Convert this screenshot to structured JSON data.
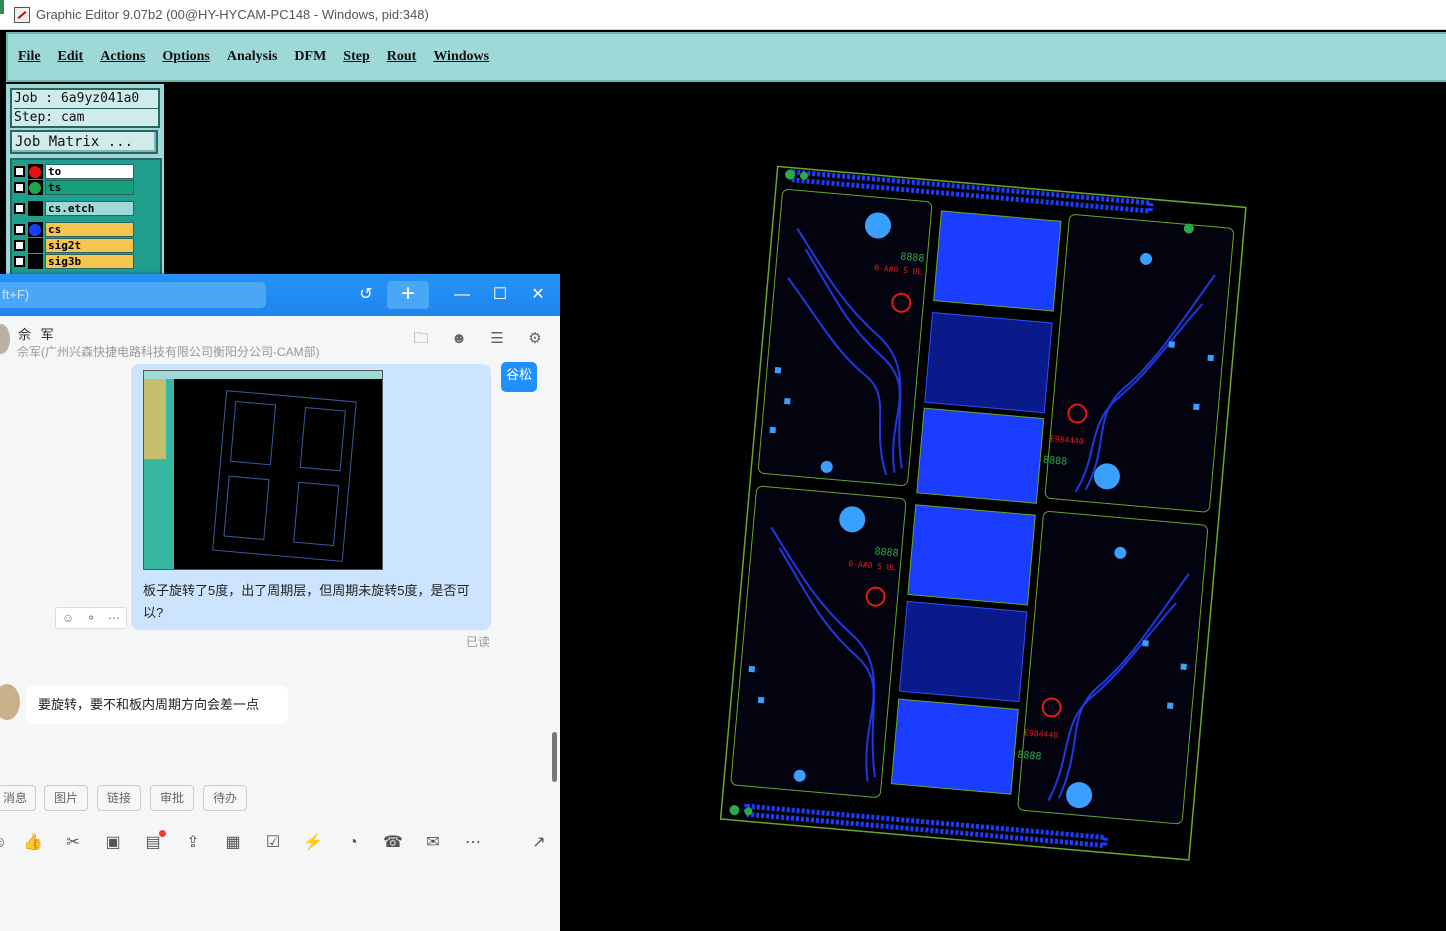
{
  "window": {
    "title": "Graphic Editor 9.07b2 (00@HY-HYCAM-PC148 - Windows, pid:348)"
  },
  "menu": [
    "File",
    "Edit",
    "Actions",
    "Options",
    "Analysis",
    "DFM",
    "Step",
    "Rout",
    "Windows"
  ],
  "left_panel": {
    "job": "Job : 6a9yz041a0",
    "step": "Step: cam",
    "job_matrix": "Job Matrix ...",
    "layers": [
      {
        "name": "to",
        "dot_color": "#e81010",
        "bg": "#ffffff"
      },
      {
        "name": "ts",
        "dot_color": "#1ea64a",
        "bg": "#15a07a"
      },
      {
        "name": "cs.etch",
        "dot_color": "#000000",
        "bg": "#9fd9d7"
      },
      {
        "name": "cs",
        "dot_color": "#1a3dff",
        "bg": "#f5c550"
      },
      {
        "name": "sig2t",
        "dot_color": "#000000",
        "bg": "#f5c550"
      },
      {
        "name": "sig3b",
        "dot_color": "#000000",
        "bg": "#f5c550"
      }
    ]
  },
  "chat": {
    "search_placeholder": "ft+F)",
    "contact_name": "佘 军",
    "contact_org": "佘军(广州兴森快捷电路科技有限公司衡阳分公司-CAM部)",
    "right_tag": "谷松",
    "message_text": "板子旋转了5度，出了周期层，但周期未旋转5度，是否可以?",
    "read_status": "已读",
    "reply_text": "要旋转，要不和板内周期方向会差一点",
    "quick_buttons": [
      "消息",
      "图片",
      "链接",
      "审批",
      "待办"
    ]
  },
  "colors": {
    "menu_bg": "#9fd9d7",
    "canvas_bg": "#000000",
    "chat_accent": "#1e90ff"
  }
}
